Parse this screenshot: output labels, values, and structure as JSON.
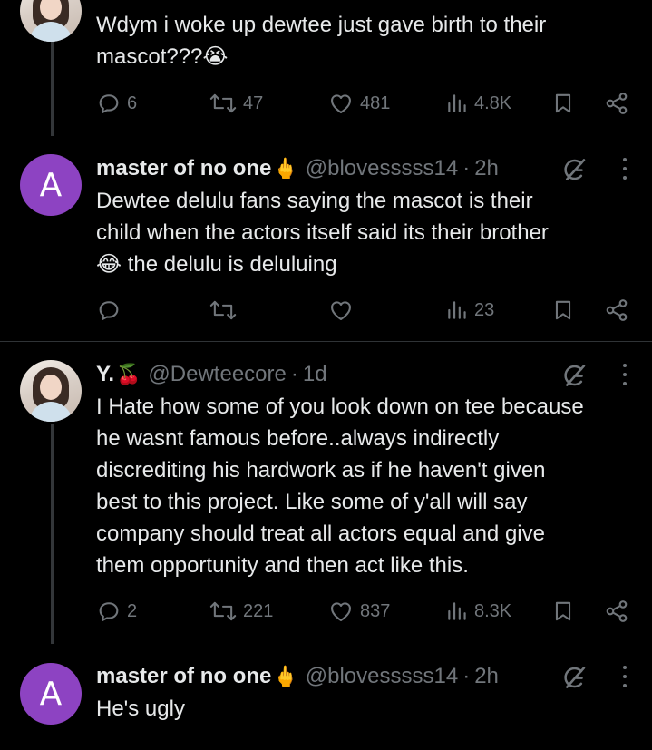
{
  "tweets": [
    {
      "text_lines": [
        "Wdym i woke up dewtee just gave birth to their",
        "mascot???😭"
      ],
      "replies": "6",
      "reposts": "47",
      "likes": "481",
      "views": "4.8K"
    },
    {
      "avatar_letter": "A",
      "name": "master of no one",
      "emoji": "🖕",
      "handle": "@blovesssss14",
      "dot": "·",
      "time": "2h",
      "text_lines": [
        "Dewtee delulu fans  saying the mascot is their",
        "child when the actors itself said its their brother",
        "😂 the delulu is deluluing"
      ],
      "replies": "",
      "reposts": "",
      "likes": "",
      "views": "23"
    },
    {
      "name": "Y.",
      "emoji": "🍒",
      "handle": "@Dewteecore",
      "dot": "·",
      "time": "1d",
      "text_lines": [
        "I Hate how some of you look down on tee because",
        "he wasnt famous before..always indirectly",
        "discrediting his hardwork as if he haven't given",
        "best to this project. Like some of y'all will say",
        "company should treat all actors equal and give",
        "them opportunity and then act like this."
      ],
      "replies": "2",
      "reposts": "221",
      "likes": "837",
      "views": "8.3K"
    },
    {
      "avatar_letter": "A",
      "name": "master of no one",
      "emoji": "🖕",
      "handle": "@blovesssss14",
      "dot": "·",
      "time": "2h",
      "text_lines": [
        "He's ugly"
      ]
    }
  ],
  "icons": {
    "reply": "reply-icon",
    "repost": "repost-icon",
    "like": "heart-icon",
    "views": "views-icon",
    "bookmark": "bookmark-icon",
    "share": "share-icon",
    "grok": "grok-icon",
    "more": "more-icon"
  },
  "colors": {
    "background": "#000000",
    "text": "#e7e9ea",
    "muted": "#71767b",
    "avatar_purple": "#8d43c2",
    "divider": "#2f3336"
  }
}
